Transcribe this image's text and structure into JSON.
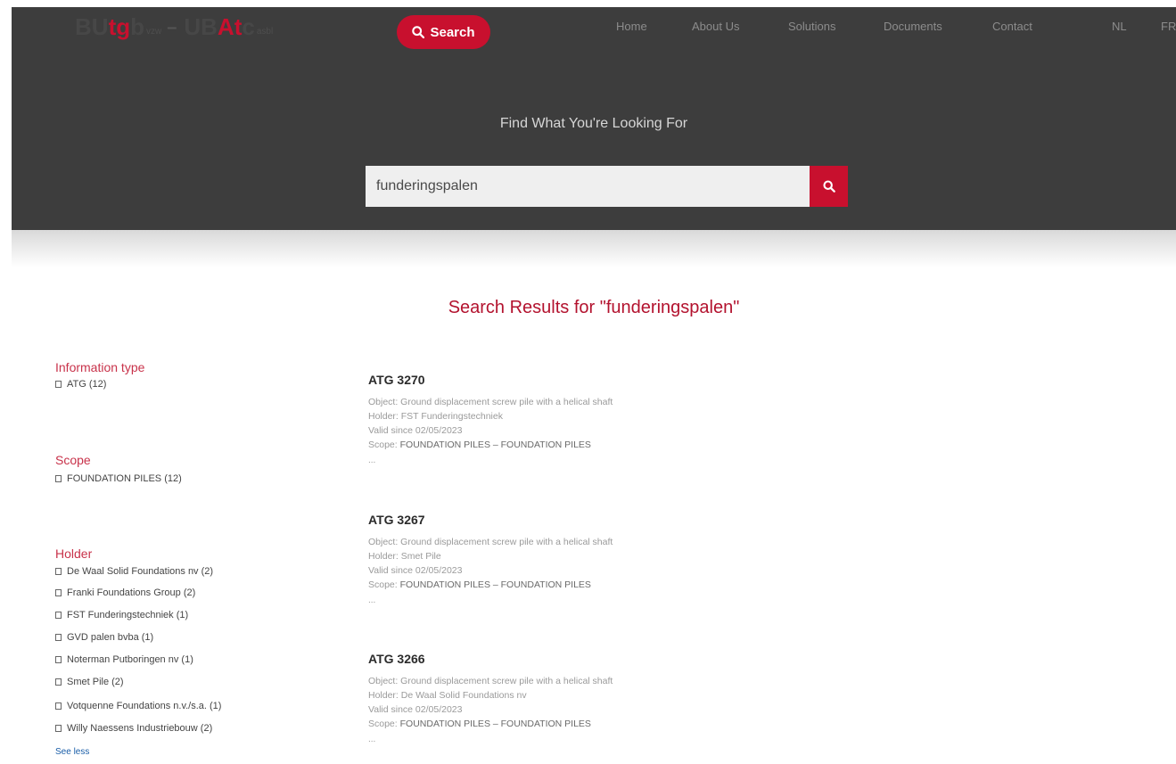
{
  "header": {
    "logo": {
      "part1": "BU",
      "part2": "tg",
      "part3": "b",
      "suffix1": "vzw",
      "dash": "–",
      "part4": "UB",
      "part5": "At",
      "part6": "c",
      "suffix2": "asbl"
    },
    "search_button_label": "Search",
    "nav": [
      "Home",
      "About Us",
      "Solutions",
      "Documents",
      "Contact",
      "NL",
      "FR"
    ]
  },
  "hero": {
    "title": "Find What You're Looking For",
    "search_value": "funderingspalen"
  },
  "results_title": "Search Results for \"funderingspalen\"",
  "facets": {
    "information_type": {
      "title": "Information type",
      "items": [
        "ATG (12)"
      ]
    },
    "scope": {
      "title": "Scope",
      "items": [
        "FOUNDATION PILES (12)"
      ]
    },
    "holder": {
      "title": "Holder",
      "items": [
        "De Waal Solid Foundations nv (2)",
        "Franki Foundations Group (2)",
        "FST Funderingstechniek (1)",
        "GVD palen bvba (1)",
        "Noterman Putboringen nv (1)",
        "Smet Pile (2)",
        "Votquenne Foundations n.v./s.a. (1)",
        "Willy Naessens Industriebouw (2)"
      ],
      "see_less": "See less"
    }
  },
  "results": [
    {
      "title": "ATG 3270",
      "object": "Object: Ground displacement screw pile with a helical shaft",
      "holder": "Holder: FST Funderingstechniek",
      "valid": "Valid since 02/05/2023",
      "scope_label": "Scope:",
      "scope_value": "FOUNDATION PILES – FOUNDATION PILES",
      "more": "..."
    },
    {
      "title": "ATG 3267",
      "object": "Object: Ground displacement screw pile with a helical shaft",
      "holder": "Holder: Smet Pile",
      "valid": "Valid since 02/05/2023",
      "scope_label": "Scope:",
      "scope_value": "FOUNDATION PILES – FOUNDATION PILES",
      "more": "..."
    },
    {
      "title": "ATG 3266",
      "object": "Object: Ground displacement screw pile with a helical shaft",
      "holder": "Holder: De Waal Solid Foundations nv",
      "valid": "Valid since 02/05/2023",
      "scope_label": "Scope:",
      "scope_value": "FOUNDATION PILES – FOUNDATION PILES",
      "more": "..."
    }
  ],
  "colors": {
    "brand_red": "#c8102e",
    "hero_bg": "#3d3d3d",
    "highlight": "#f5f51c"
  }
}
